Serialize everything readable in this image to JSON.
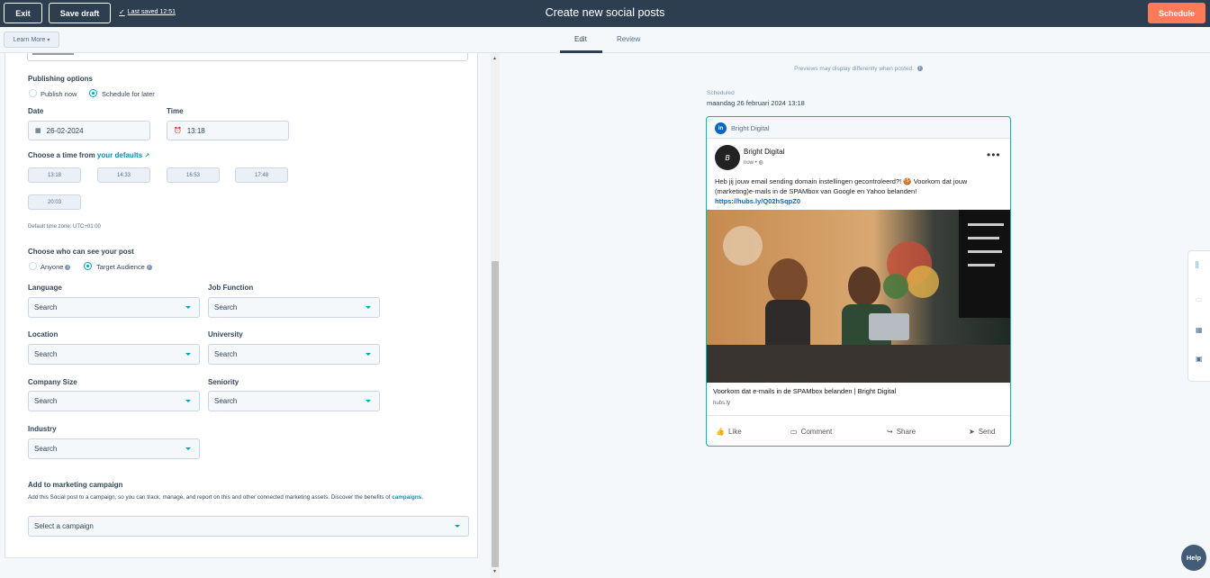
{
  "topbar": {
    "exit_label": "Exit",
    "save_draft_label": "Save draft",
    "last_saved": "Last saved 12:51",
    "title": "Create new social posts",
    "schedule_label": "Schedule"
  },
  "subbar": {
    "learn_more": "Learn More",
    "tabs": [
      {
        "label": "Edit",
        "active": true
      },
      {
        "label": "Review",
        "active": false
      }
    ]
  },
  "form": {
    "publishing_options_label": "Publishing options",
    "publish_now_label": "Publish now",
    "schedule_later_label": "Schedule for later",
    "schedule_later_selected": true,
    "date_label": "Date",
    "date_value": "26-02-2024",
    "time_label": "Time",
    "time_value": "13:18",
    "choose_time_prefix": "Choose a time from",
    "your_defaults": "your defaults",
    "time_chips": [
      "13:18",
      "14:33",
      "16:53",
      "17:48",
      "20:03"
    ],
    "default_timezone": "Default time zone: UTC+01:00",
    "audience_label": "Choose who can see your post",
    "anyone_label": "Anyone",
    "target_audience_label": "Target Audience",
    "target_audience_selected": true,
    "fields": {
      "language": {
        "label": "Language",
        "placeholder": "Search"
      },
      "job_function": {
        "label": "Job Function",
        "placeholder": "Search"
      },
      "location": {
        "label": "Location",
        "placeholder": "Search"
      },
      "university": {
        "label": "University",
        "placeholder": "Search"
      },
      "company_size": {
        "label": "Company Size",
        "placeholder": "Search"
      },
      "seniority": {
        "label": "Seniority",
        "placeholder": "Search"
      },
      "industry": {
        "label": "Industry",
        "placeholder": "Search"
      }
    },
    "campaign_label": "Add to marketing campaign",
    "campaign_desc": "Add this Social post to a campaign, so you can track, manage, and report on this and other connected marketing assets. Discover the benefits of",
    "campaign_link": "campaigns",
    "campaign_select": "Select a campaign"
  },
  "preview": {
    "note": "Previews may display differently when posted.",
    "scheduled_label": "Scheduled",
    "scheduled_date": "maandag 26 februari 2024 13:18",
    "account_name": "Bright Digital",
    "author": "Bright Digital",
    "meta": "now •",
    "post_text": "Heb jij jouw email sending domain instellingen gecontroleerd?! 🍪 Voorkom dat jouw (marketing)e-mails in de SPAMbox van Google en Yahoo belanden!",
    "post_link": "https://hubs.ly/Q02hSqpZ0",
    "link_title": "Voorkom dat e-mails in de SPAMbox belanden | Bright Digital",
    "link_domain": "hubs.ly",
    "actions": [
      "Like",
      "Comment",
      "Share",
      "Send"
    ]
  },
  "help_label": "Help",
  "colors": {
    "topbar": "#2d3e50",
    "accent_orange": "#ff7a59",
    "accent_teal": "#00a4bd",
    "linkedin_blue": "#0a66c2"
  }
}
